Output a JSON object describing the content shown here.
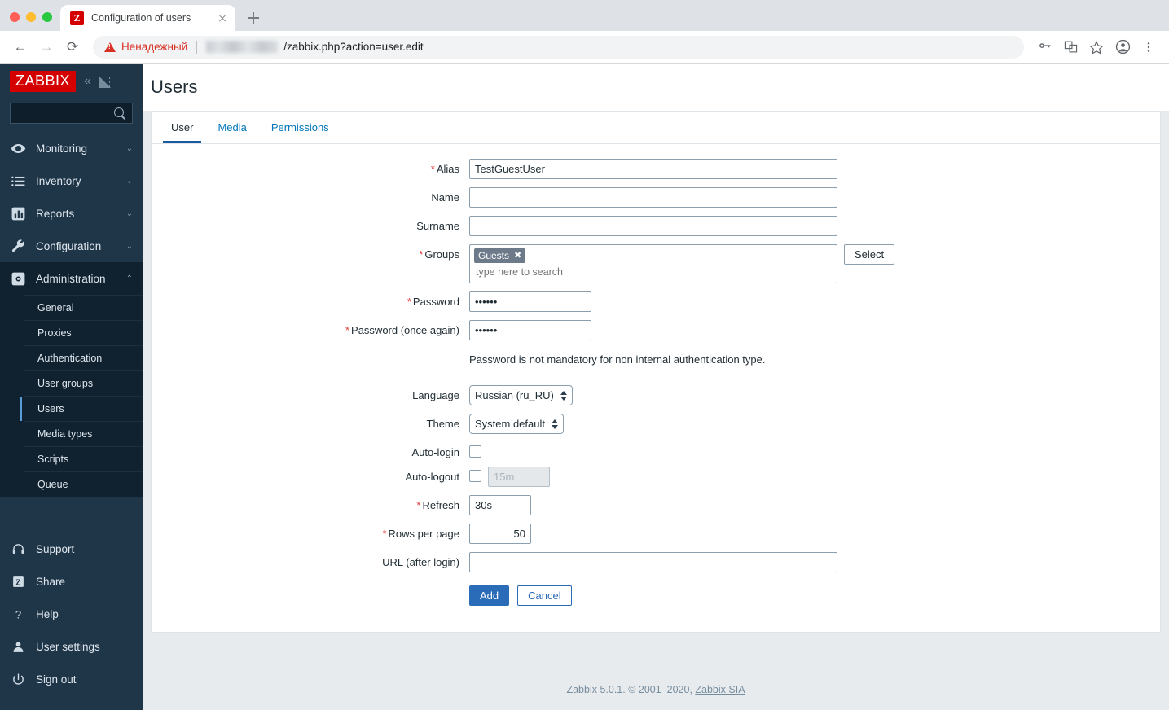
{
  "browser": {
    "tab": {
      "title": "Configuration of users",
      "favicon_letter": "Z",
      "close_icon": "close-icon"
    },
    "new_tab_label": "+",
    "nav": {
      "back": "←",
      "forward": "→",
      "reload": "⟳"
    },
    "omnibox": {
      "security_label": "Ненадежный",
      "url_path": "/zabbix.php?action=user.edit",
      "host_redacted": true
    },
    "toolbar_icons": [
      "key-icon",
      "translate-icon",
      "bookmark-star-icon",
      "profile-avatar-icon",
      "overflow-menu-icon"
    ]
  },
  "sidebar": {
    "logo": "ZABBIX",
    "collapse_icon": "«",
    "hide_icon": "collapse-sidebar-icon",
    "search": {
      "value": "",
      "placeholder": ""
    },
    "menu": [
      {
        "label": "Monitoring",
        "icon": "eye-icon",
        "expandable": true,
        "expanded": false
      },
      {
        "label": "Inventory",
        "icon": "list-icon",
        "expandable": true,
        "expanded": false
      },
      {
        "label": "Reports",
        "icon": "bar-chart-icon",
        "expandable": true,
        "expanded": false
      },
      {
        "label": "Configuration",
        "icon": "wrench-icon",
        "expandable": true,
        "expanded": false
      },
      {
        "label": "Administration",
        "icon": "gear-icon",
        "expandable": true,
        "expanded": true
      }
    ],
    "submenu": [
      {
        "label": "General",
        "active": false
      },
      {
        "label": "Proxies",
        "active": false
      },
      {
        "label": "Authentication",
        "active": false
      },
      {
        "label": "User groups",
        "active": false
      },
      {
        "label": "Users",
        "active": true
      },
      {
        "label": "Media types",
        "active": false
      },
      {
        "label": "Scripts",
        "active": false
      },
      {
        "label": "Queue",
        "active": false
      }
    ],
    "bottom": [
      {
        "label": "Support",
        "icon": "headset-icon"
      },
      {
        "label": "Share",
        "icon": "zabbix-share-icon"
      },
      {
        "label": "Help",
        "icon": "question-mark-icon"
      },
      {
        "label": "User settings",
        "icon": "person-icon"
      },
      {
        "label": "Sign out",
        "icon": "power-icon"
      }
    ],
    "accent_color": "#5a9bd8",
    "bg_color": "#1f3548"
  },
  "page": {
    "title": "Users",
    "tabs": [
      {
        "label": "User",
        "active": true
      },
      {
        "label": "Media",
        "active": false
      },
      {
        "label": "Permissions",
        "active": false
      }
    ]
  },
  "form": {
    "alias": {
      "label": "Alias",
      "required": true,
      "value": "TestGuestUser"
    },
    "name": {
      "label": "Name",
      "required": false,
      "value": ""
    },
    "surname": {
      "label": "Surname",
      "required": false,
      "value": ""
    },
    "groups": {
      "label": "Groups",
      "required": true,
      "chips": [
        "Guests"
      ],
      "chip_remove_icon": "✖",
      "placeholder": "type here to search",
      "select_button": "Select"
    },
    "password": {
      "label": "Password",
      "required": true,
      "value": "••••••"
    },
    "password_again": {
      "label": "Password (once again)",
      "required": true,
      "value": "••••••"
    },
    "password_hint": "Password is not mandatory for non internal authentication type.",
    "language": {
      "label": "Language",
      "value": "Russian (ru_RU)"
    },
    "theme": {
      "label": "Theme",
      "value": "System default"
    },
    "auto_login": {
      "label": "Auto-login",
      "checked": false
    },
    "auto_logout": {
      "label": "Auto-logout",
      "checked": false,
      "value": "",
      "placeholder": "15m",
      "disabled": true
    },
    "refresh": {
      "label": "Refresh",
      "required": true,
      "value": "30s"
    },
    "rows_per_page": {
      "label": "Rows per page",
      "required": true,
      "value": "50"
    },
    "url_after_login": {
      "label": "URL (after login)",
      "required": false,
      "value": ""
    },
    "submit_button": "Add",
    "cancel_button": "Cancel",
    "required_marker": "*"
  },
  "footer": {
    "text": "Zabbix 5.0.1. © 2001–2020, ",
    "link": "Zabbix SIA"
  }
}
